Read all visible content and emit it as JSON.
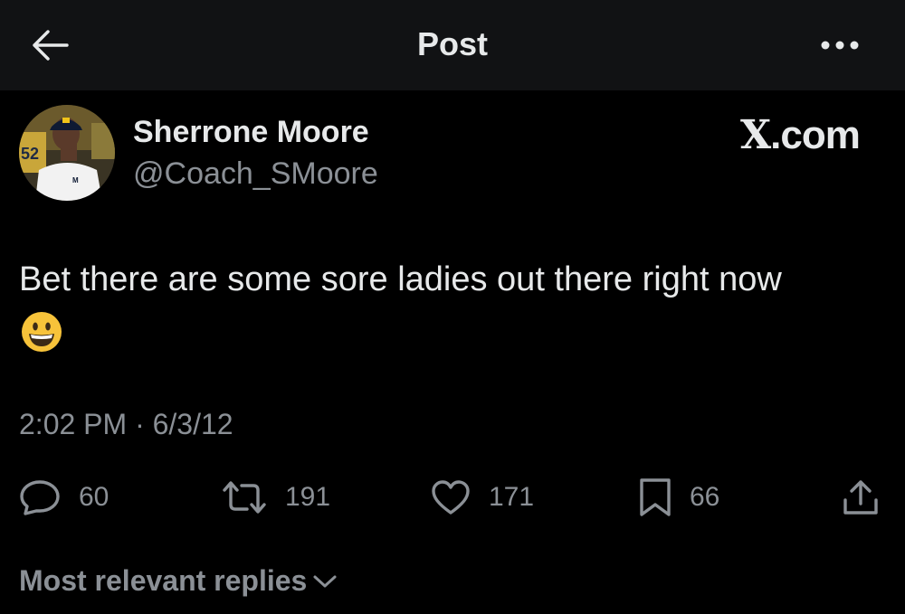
{
  "header": {
    "title": "Post",
    "back_icon": "arrow-left-icon",
    "more_icon": "more-horizontal-icon"
  },
  "author": {
    "name": "Sherrone Moore",
    "handle": "@Coach_SMoore"
  },
  "brand": {
    "x": "X",
    "suffix": ".com"
  },
  "tweet": {
    "text": "Bet there are some sore ladies out there right now",
    "emoji": "grinning-face-emoji"
  },
  "meta": {
    "time": "2:02 PM",
    "separator": "·",
    "date": "6/3/12"
  },
  "actions": {
    "replies": {
      "icon": "reply-icon",
      "count": "60"
    },
    "reposts": {
      "icon": "repost-icon",
      "count": "191"
    },
    "likes": {
      "icon": "heart-icon",
      "count": "171"
    },
    "bookmarks": {
      "icon": "bookmark-icon",
      "count": "66"
    },
    "share": {
      "icon": "share-icon"
    }
  },
  "replies_filter": {
    "label": "Most relevant replies"
  },
  "colors": {
    "background": "#000000",
    "header": "#111214",
    "text": "#e7e9ea",
    "muted": "#8b9096"
  }
}
